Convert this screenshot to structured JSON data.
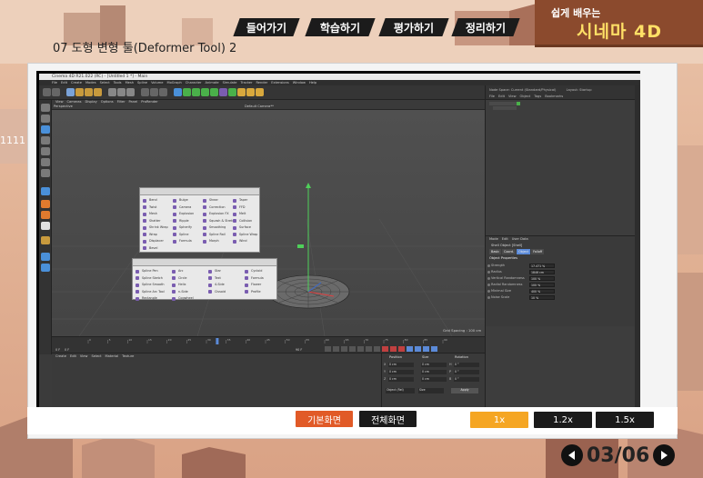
{
  "header": {
    "nav_tabs": [
      {
        "label": "들어가기"
      },
      {
        "label": "학습하기"
      },
      {
        "label": "평가하기"
      },
      {
        "label": "정리하기"
      }
    ],
    "brand_sub": "쉽게 배우는",
    "brand_main": "시네마 4D"
  },
  "page_title": "07 도형 변형 툴(Deformer Tool) 2",
  "app": {
    "window_title": "Cinema 4D R21.022 (RC) - [Untitled 1 *] - Main",
    "menu": [
      "File",
      "Edit",
      "Create",
      "Modes",
      "Select",
      "Tools",
      "Mesh",
      "Spline",
      "Volume",
      "MoGraph",
      "Character",
      "Animate",
      "Simulate",
      "Tracker",
      "Render",
      "Extensions",
      "Window",
      "Help"
    ],
    "viewport_menu": [
      "View",
      "Cameras",
      "Display",
      "Options",
      "Filter",
      "Panel",
      "ProRender"
    ],
    "viewport_label": "Perspective",
    "camera_label": "Default Camera**",
    "grid_spacing": "Grid Spacing : 100 cm",
    "node_space": "Node Space: Current (Standard/Physical)",
    "layout": "Layout: Startup",
    "object_menu": [
      "File",
      "Edit",
      "View",
      "Object",
      "Tags",
      "Bookmarks"
    ],
    "attr_menu": [
      "Mode",
      "Edit",
      "User Data"
    ],
    "attr_title": "Shell Object [Shell]",
    "attr_tabs": [
      "Basic",
      "Coord.",
      "Object",
      "Falloff"
    ],
    "attr_section": "Object Properties",
    "attr_rows": [
      {
        "label": "Strength",
        "value": "17.471 %"
      },
      {
        "label": "Radius",
        "value": "1846 cm"
      },
      {
        "label": "Vertical Randomness",
        "value": "100 %"
      },
      {
        "label": "Radial Randomness",
        "value": "100 %"
      },
      {
        "label": "Minimal Size",
        "value": "400 %"
      },
      {
        "label": "Noise Scale",
        "value": "10 %"
      }
    ],
    "deformer_menu": [
      "Bend",
      "Bulge",
      "Shear",
      "Taper",
      "Twist",
      "Camera",
      "Correction",
      "FFD",
      "Mesh",
      "Explosion",
      "Explosion FX",
      "Melt",
      "Shatter",
      "Ripple",
      "Squash & Stretch",
      "Collision",
      "Shrink Wrap",
      "Spherify",
      "Smoothing",
      "Surface",
      "Wrap",
      "Spline",
      "Spline Rail",
      "Spline Wrap",
      "Displacer",
      "Formula",
      "Morph",
      "Wind",
      "Bevel"
    ],
    "spline_menu": [
      "Spline Pen",
      "Arc",
      "Star",
      "Cycloid",
      "Spline Sketch",
      "Circle",
      "Text",
      "Formula",
      "Spline Smooth",
      "Helix",
      "4-Side",
      "Flower",
      "Spline Arc Tool",
      "n-Side",
      "Cissoid",
      "Profile",
      "Rectangle",
      "Cogwheel"
    ],
    "materials_menu": [
      "Create",
      "Edit",
      "View",
      "Select",
      "Material",
      "Texture"
    ],
    "coord_headers": [
      "Position",
      "Size",
      "Rotation"
    ],
    "coord_rows": [
      {
        "axis": "X",
        "pos": "0 cm",
        "size": "0 cm",
        "rot_axis": "H",
        "rot": "0 °"
      },
      {
        "axis": "Y",
        "pos": "0 cm",
        "size": "0 cm",
        "rot_axis": "P",
        "rot": "0 °"
      },
      {
        "axis": "Z",
        "pos": "0 cm",
        "size": "0 cm",
        "rot_axis": "B",
        "rot": "0 °"
      }
    ],
    "coord_mode": "Object (Rel)",
    "coord_size_mode": "Size",
    "apply": "Apply",
    "frame_start": "0 F",
    "frame_current": "0 F",
    "frame_end": "90 F",
    "timeline_ticks": [
      "0",
      "5",
      "10",
      "15",
      "20",
      "25",
      "30",
      "35",
      "40",
      "45",
      "50",
      "55",
      "60",
      "65",
      "70",
      "75",
      "80",
      "85",
      "90"
    ],
    "timeline_position": 0.36
  },
  "controls": {
    "basic_view": "기본화면",
    "full_view": "전체화면",
    "speed_1": "1x",
    "speed_12": "1.2x",
    "speed_15": "1.5x"
  },
  "pager": {
    "text": "03/06"
  },
  "colors": {
    "basic_view_bg": "#e15a27",
    "speed_active_bg": "#f5a623",
    "dark_btn": "#1a1a1a",
    "brand_yellow": "#ffe066"
  }
}
